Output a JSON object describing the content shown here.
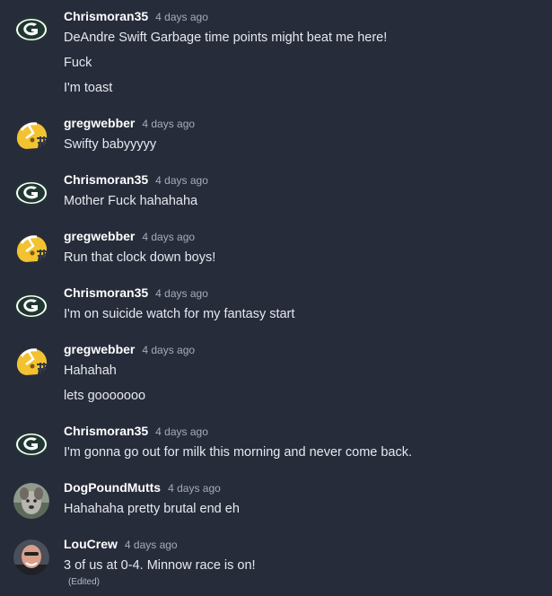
{
  "messages": [
    {
      "user": "Chrismoran35",
      "time": "4 days ago",
      "avatar": "packers-logo-icon",
      "lines": [
        "DeAndre Swift Garbage time points might beat me here!",
        "Fuck",
        "I'm toast"
      ]
    },
    {
      "user": "gregwebber",
      "time": "4 days ago",
      "avatar": "football-helmet-icon",
      "lines": [
        "Swifty babyyyyy"
      ]
    },
    {
      "user": "Chrismoran35",
      "time": "4 days ago",
      "avatar": "packers-logo-icon",
      "lines": [
        "Mother Fuck hahahaha"
      ]
    },
    {
      "user": "gregwebber",
      "time": "4 days ago",
      "avatar": "football-helmet-icon",
      "lines": [
        "Run that clock down boys!"
      ]
    },
    {
      "user": "Chrismoran35",
      "time": "4 days ago",
      "avatar": "packers-logo-icon",
      "lines": [
        "I'm on suicide watch for my fantasy start"
      ]
    },
    {
      "user": "gregwebber",
      "time": "4 days ago",
      "avatar": "football-helmet-icon",
      "lines": [
        "Hahahah",
        "lets gooooooo"
      ]
    },
    {
      "user": "Chrismoran35",
      "time": "4 days ago",
      "avatar": "packers-logo-icon",
      "lines": [
        "I'm gonna go out for milk this morning and never come back."
      ]
    },
    {
      "user": "DogPoundMutts",
      "time": "4 days ago",
      "avatar": "dog-photo-avatar",
      "lines": [
        "Hahahaha pretty brutal end eh"
      ]
    },
    {
      "user": "LouCrew",
      "time": "4 days ago",
      "avatar": "person-photo-avatar",
      "lines": [
        "3 of us at 0-4. Minnow race is on!"
      ],
      "edited": "(Edited)"
    }
  ],
  "colors": {
    "background": "#272c3b",
    "packers_green": "#203731",
    "packers_gold": "#ffb612",
    "helmet_yellow": "#f2c230"
  }
}
